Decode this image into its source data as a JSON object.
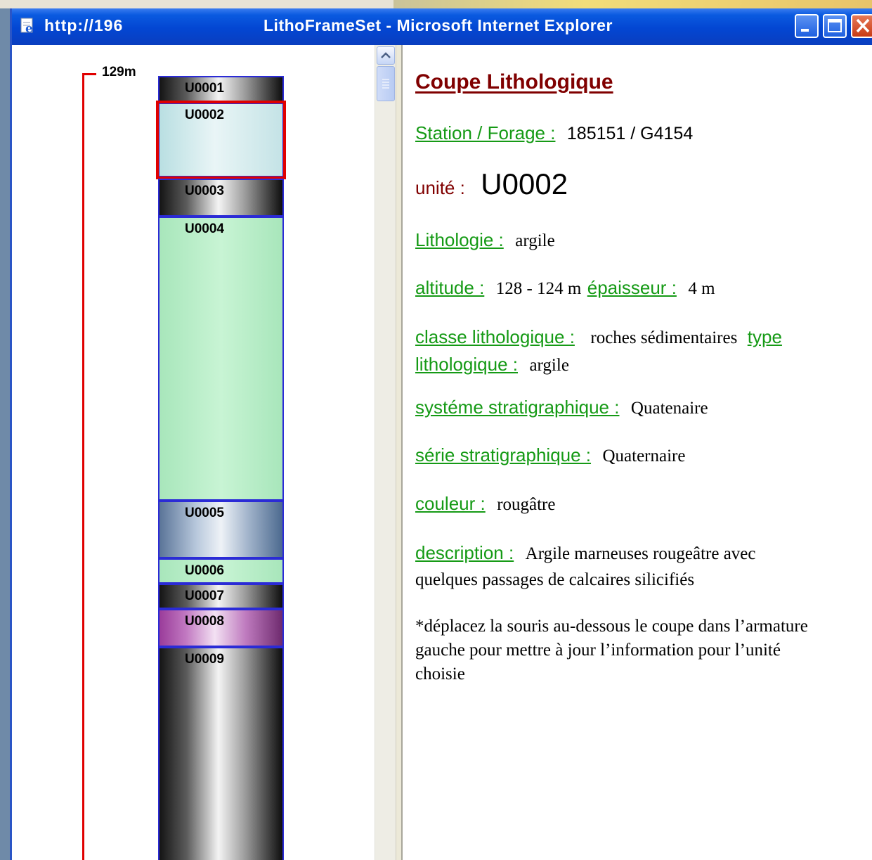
{
  "window": {
    "url": "http://196",
    "title": "LithoFrameSet - Microsoft Internet Explorer"
  },
  "column": {
    "top_depth_label": "129m",
    "units": [
      {
        "id": "U0001",
        "fill": "dark-metallic"
      },
      {
        "id": "U0002",
        "fill": "pale-blue",
        "selected": true
      },
      {
        "id": "U0003",
        "fill": "dark-metallic"
      },
      {
        "id": "U0004",
        "fill": "light-green"
      },
      {
        "id": "U0005",
        "fill": "steel-blue"
      },
      {
        "id": "U0006",
        "fill": "light-green"
      },
      {
        "id": "U0007",
        "fill": "dark-metallic"
      },
      {
        "id": "U0008",
        "fill": "purple"
      },
      {
        "id": "U0009",
        "fill": "dark-metallic"
      }
    ]
  },
  "info": {
    "heading": "Coupe Lithologique",
    "station_label": "Station / Forage :",
    "station_value": "185151 / G4154",
    "unite_label": "unité :",
    "unite_value": "U0002",
    "lithologie_label": "Lithologie :",
    "lithologie_value": "argile",
    "altitude_label": "altitude :",
    "altitude_value": "128 - 124 m",
    "epaisseur_label": "épaisseur :",
    "epaisseur_value": "4 m",
    "classe_label": "classe lithologique :",
    "classe_value": "roches sédimentaires",
    "type_label_1": "type",
    "type_label_2": "lithologique :",
    "type_value": "argile",
    "systeme_label": "systéme stratigraphique :",
    "systeme_value": "Quatenaire",
    "serie_label": "série stratigraphique :",
    "serie_value": "Quaternaire",
    "couleur_label": "couleur :",
    "couleur_value": "rougâtre",
    "description_label": "description :",
    "description_value_1": "Argile marneuses rougeâtre avec",
    "description_value_2": "quelques passages de calcaires silicifiés",
    "note_1": "*déplacez la souris au-dessous le coupe dans l’armature",
    "note_2": "gauche pour mettre à jour l’information pour l’unité",
    "note_3": "choisie"
  },
  "colors": {
    "label_green": "#159a15",
    "heading_maroon": "#800000",
    "selection_red": "#e00000",
    "unit_border": "#2b2bd6"
  }
}
